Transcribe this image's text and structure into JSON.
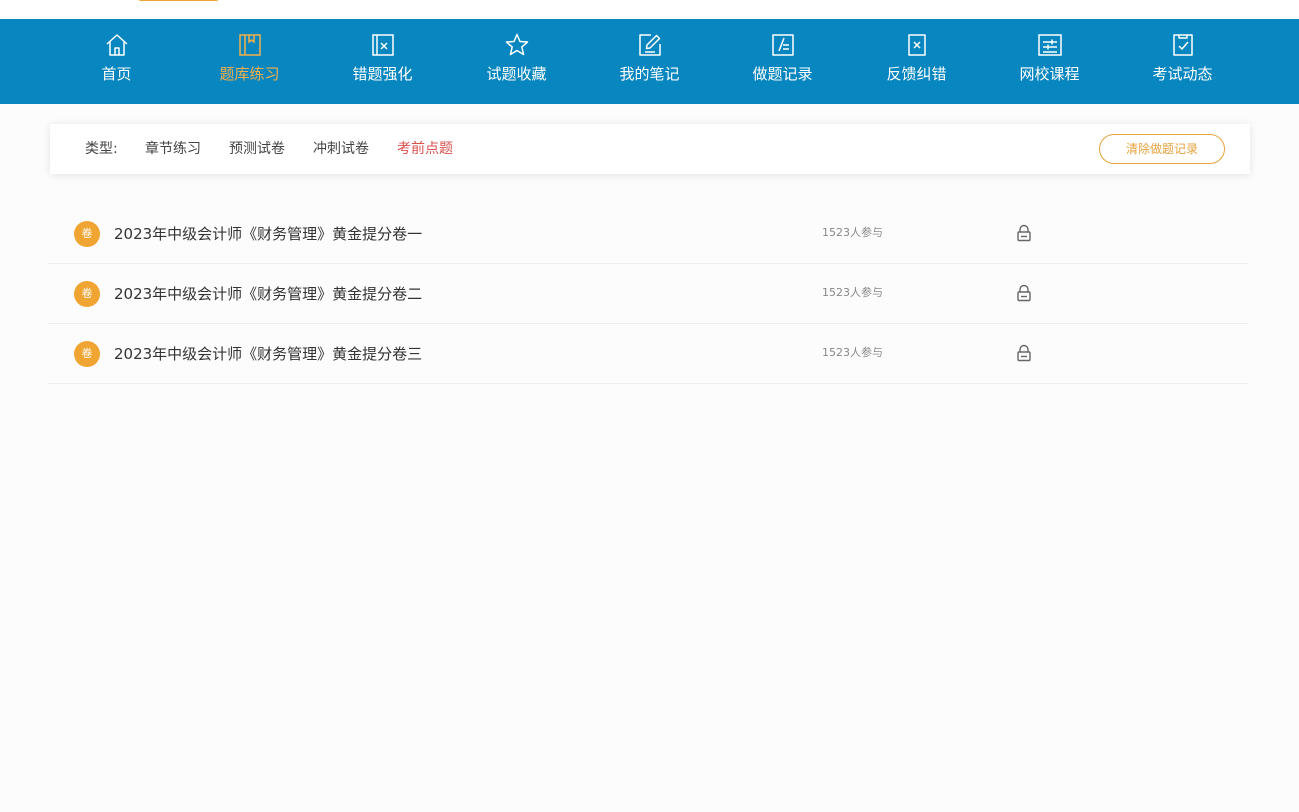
{
  "nav": {
    "items": [
      {
        "label": "首页",
        "icon": "home-icon"
      },
      {
        "label": "题库练习",
        "icon": "book-icon",
        "active": true
      },
      {
        "label": "错题强化",
        "icon": "error-doc-icon"
      },
      {
        "label": "试题收藏",
        "icon": "star-icon"
      },
      {
        "label": "我的笔记",
        "icon": "note-edit-icon"
      },
      {
        "label": "做题记录",
        "icon": "record-icon"
      },
      {
        "label": "反馈纠错",
        "icon": "feedback-x-icon"
      },
      {
        "label": "网校课程",
        "icon": "course-sliders-icon"
      },
      {
        "label": "考试动态",
        "icon": "check-doc-icon"
      }
    ]
  },
  "filter": {
    "label": "类型:",
    "options": [
      {
        "label": "章节练习"
      },
      {
        "label": "预测试卷"
      },
      {
        "label": "冲刺试卷"
      },
      {
        "label": "考前点题",
        "active": true
      }
    ],
    "clear_button": "清除做题记录"
  },
  "papers": [
    {
      "badge": "卷",
      "title": "2023年中级会计师《财务管理》黄金提分卷一",
      "participants": "1523人参与",
      "locked": true
    },
    {
      "badge": "卷",
      "title": "2023年中级会计师《财务管理》黄金提分卷二",
      "participants": "1523人参与",
      "locked": true
    },
    {
      "badge": "卷",
      "title": "2023年中级会计师《财务管理》黄金提分卷三",
      "participants": "1523人参与",
      "locked": true
    }
  ],
  "colors": {
    "nav_bg": "#0786bf",
    "active_nav": "#f3b04a",
    "active_filter": "#d9534f",
    "badge": "#f0a533",
    "clear_button": "#e6a23c"
  }
}
